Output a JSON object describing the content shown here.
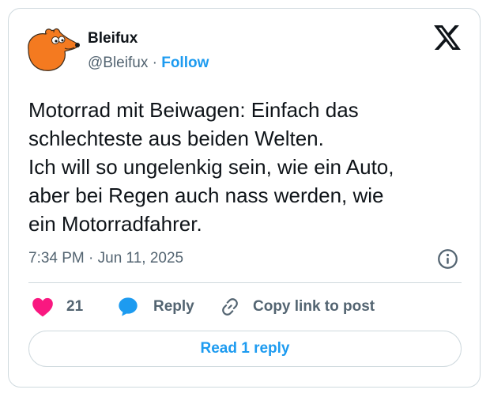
{
  "author": {
    "name": "Bleifux",
    "handle": "@Bleifux",
    "separator": "·",
    "follow_label": "Follow",
    "avatar_icon": "orange-fox-mascot"
  },
  "brand": {
    "logo_icon": "x-logo"
  },
  "tweet": {
    "lines": [
      "Motorrad mit Beiwagen: Einfach das",
      "schlechteste aus beiden Welten.",
      "Ich will so ungelenkig sein, wie ein Auto,",
      "aber bei Regen auch nass werden, wie",
      "ein Motorradfahrer."
    ],
    "timestamp": "7:34 PM · Jun 11, 2025",
    "info_icon": "info-icon"
  },
  "actions": {
    "like_count": "21",
    "like_icon": "heart-icon",
    "reply_label": "Reply",
    "reply_icon": "speech-bubble-icon",
    "copy_label": "Copy link to post",
    "copy_icon": "link-icon"
  },
  "footer": {
    "read_replies_label": "Read 1 reply"
  },
  "colors": {
    "accent": "#1d9bf0",
    "heart": "#f91880",
    "text": "#0f1419",
    "muted": "#536471",
    "border": "#cfd9de",
    "fox": "#f47a20"
  }
}
